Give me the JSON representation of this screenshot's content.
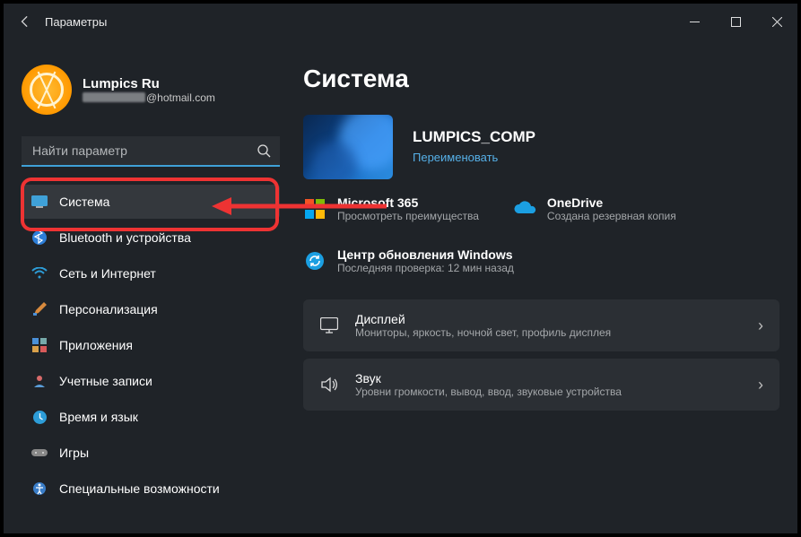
{
  "window": {
    "title": "Параметры"
  },
  "profile": {
    "name": "Lumpics Ru",
    "email_suffix": "@hotmail.com"
  },
  "search": {
    "placeholder": "Найти параметр"
  },
  "nav": {
    "system": "Система",
    "bluetooth": "Bluetooth и устройства",
    "network": "Сеть и Интернет",
    "personalization": "Персонализация",
    "apps": "Приложения",
    "accounts": "Учетные записи",
    "time": "Время и язык",
    "games": "Игры",
    "accessibility": "Специальные возможности"
  },
  "main": {
    "heading": "Система",
    "device_name": "LUMPICS_COMP",
    "rename": "Переименовать",
    "m365": {
      "title": "Microsoft 365",
      "sub": "Просмотреть преимущества"
    },
    "onedrive": {
      "title": "OneDrive",
      "sub": "Создана резервная копия"
    },
    "update": {
      "title": "Центр обновления Windows",
      "sub": "Последняя проверка: 12 мин назад"
    },
    "display": {
      "title": "Дисплей",
      "sub": "Мониторы, яркость, ночной свет, профиль дисплея"
    },
    "sound": {
      "title": "Звук",
      "sub": "Уровни громкости, вывод, ввод, звуковые устройства"
    }
  }
}
